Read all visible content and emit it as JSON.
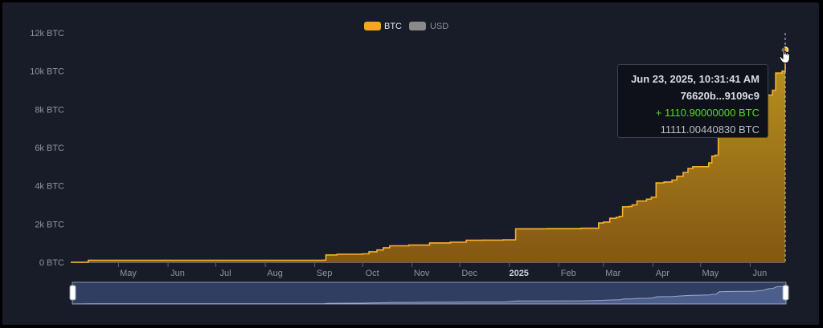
{
  "chart_data": {
    "type": "area",
    "title": "",
    "legend": [
      {
        "name": "BTC",
        "color": "#f5a623",
        "active": true
      },
      {
        "name": "USD",
        "color": "#8a8a8a",
        "active": false
      }
    ],
    "legend_position": "top-center",
    "y_ticks": [
      "0 BTC",
      "2k BTC",
      "4k BTC",
      "6k BTC",
      "8k BTC",
      "10k BTC",
      "12k BTC"
    ],
    "ylim": [
      0,
      12000
    ],
    "x_range": [
      "2024-04-01",
      "2025-06-23"
    ],
    "x_ticks": [
      {
        "label": "May",
        "date": "2024-05-01"
      },
      {
        "label": "Jun",
        "date": "2024-06-01"
      },
      {
        "label": "Jul",
        "date": "2024-07-01"
      },
      {
        "label": "Aug",
        "date": "2024-08-01"
      },
      {
        "label": "Sep",
        "date": "2024-09-01"
      },
      {
        "label": "Oct",
        "date": "2024-10-01"
      },
      {
        "label": "Nov",
        "date": "2024-11-01"
      },
      {
        "label": "Dec",
        "date": "2024-12-01"
      },
      {
        "label": "2025",
        "date": "2025-01-01",
        "bold": true
      },
      {
        "label": "Feb",
        "date": "2025-02-01"
      },
      {
        "label": "Mar",
        "date": "2025-03-01"
      },
      {
        "label": "Apr",
        "date": "2025-04-01"
      },
      {
        "label": "May",
        "date": "2025-05-01"
      },
      {
        "label": "Jun",
        "date": "2025-06-01"
      }
    ],
    "grid": {
      "horizontal": false,
      "vertical": false
    },
    "series": [
      {
        "name": "BTC",
        "step": true,
        "points": [
          [
            "2024-04-01",
            0
          ],
          [
            "2024-04-12",
            100
          ],
          [
            "2024-08-31",
            100
          ],
          [
            "2024-09-06",
            110
          ],
          [
            "2024-09-08",
            380
          ],
          [
            "2024-09-15",
            420
          ],
          [
            "2024-10-01",
            440
          ],
          [
            "2024-10-05",
            550
          ],
          [
            "2024-10-10",
            640
          ],
          [
            "2024-10-14",
            760
          ],
          [
            "2024-10-18",
            860
          ],
          [
            "2024-10-30",
            900
          ],
          [
            "2024-11-12",
            1010
          ],
          [
            "2024-11-25",
            1050
          ],
          [
            "2024-12-05",
            1150
          ],
          [
            "2024-12-15",
            1160
          ],
          [
            "2024-12-28",
            1170
          ],
          [
            "2025-01-05",
            1750
          ],
          [
            "2025-01-25",
            1760
          ],
          [
            "2025-02-15",
            1780
          ],
          [
            "2025-02-26",
            2050
          ],
          [
            "2025-03-01",
            2100
          ],
          [
            "2025-03-05",
            2300
          ],
          [
            "2025-03-09",
            2350
          ],
          [
            "2025-03-11",
            2400
          ],
          [
            "2025-03-13",
            2900
          ],
          [
            "2025-03-17",
            2920
          ],
          [
            "2025-03-19",
            3000
          ],
          [
            "2025-03-22",
            3200
          ],
          [
            "2025-03-28",
            3300
          ],
          [
            "2025-03-31",
            3400
          ],
          [
            "2025-04-03",
            4150
          ],
          [
            "2025-04-08",
            4200
          ],
          [
            "2025-04-13",
            4300
          ],
          [
            "2025-04-16",
            4500
          ],
          [
            "2025-04-20",
            4700
          ],
          [
            "2025-04-23",
            4900
          ],
          [
            "2025-04-26",
            5000
          ],
          [
            "2025-05-06",
            5200
          ],
          [
            "2025-05-08",
            5550
          ],
          [
            "2025-05-10",
            5600
          ],
          [
            "2025-05-12",
            7000
          ],
          [
            "2025-05-20",
            7200
          ],
          [
            "2025-05-28",
            7250
          ],
          [
            "2025-06-02",
            7300
          ],
          [
            "2025-06-08",
            7700
          ],
          [
            "2025-06-12",
            8750
          ],
          [
            "2025-06-15",
            9000
          ],
          [
            "2025-06-17",
            9900
          ],
          [
            "2025-06-21",
            10000
          ],
          [
            "2025-06-23",
            11111.0044083
          ]
        ]
      }
    ],
    "tooltip": {
      "date": "Jun 23, 2025, 10:31:41 AM",
      "tx": "76620b...9109c9",
      "delta": "+ 1110.90000000 BTC",
      "balance": "11111.00440830 BTC"
    },
    "range_selector": {
      "start": "2024-04-01",
      "end": "2025-06-23"
    }
  }
}
